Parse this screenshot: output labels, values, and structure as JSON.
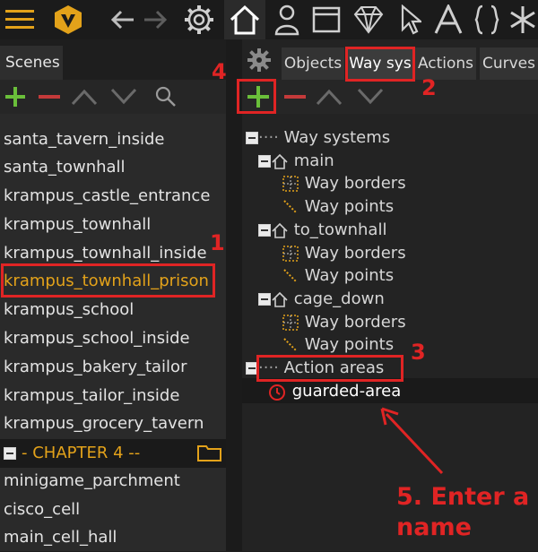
{
  "scenes_panel": {
    "tab_label": "Scenes",
    "items": [
      "santa_tavern_inside",
      "santa_townhall",
      "krampus_castle_entrance",
      "krampus_townhall",
      "krampus_townhall_inside",
      "krampus_townhall_prison",
      "krampus_school",
      "krampus_school_inside",
      "krampus_bakery_tailor",
      "krampus_tailor_inside",
      "krampus_grocery_tavern",
      "- CHAPTER 4 --",
      "minigame_parchment",
      "cisco_cell",
      "main_cell_hall"
    ],
    "selected_index": 5
  },
  "right_panel": {
    "tabs": [
      "Objects",
      "Way sys",
      "Actions",
      "Curves"
    ],
    "active_tab": "Way sys",
    "tree": {
      "root": "Way systems",
      "systems": [
        {
          "name": "main",
          "children": [
            "Way borders",
            "Way points"
          ]
        },
        {
          "name": "to_townhall",
          "children": [
            "Way borders",
            "Way points"
          ]
        },
        {
          "name": "cage_down",
          "children": [
            "Way borders",
            "Way points"
          ]
        }
      ],
      "action_areas": "Action areas",
      "area_item": "guarded-area"
    }
  },
  "annotations": {
    "n1": "1",
    "n2": "2",
    "n3": "3",
    "n4": "4",
    "instruction_line1": "5. Enter a",
    "instruction_line2": "name"
  },
  "colors": {
    "accent": "#e3a21a",
    "annotation": "#e02424",
    "add_green": "#6abf3a",
    "remove_red": "#c43a3a"
  }
}
